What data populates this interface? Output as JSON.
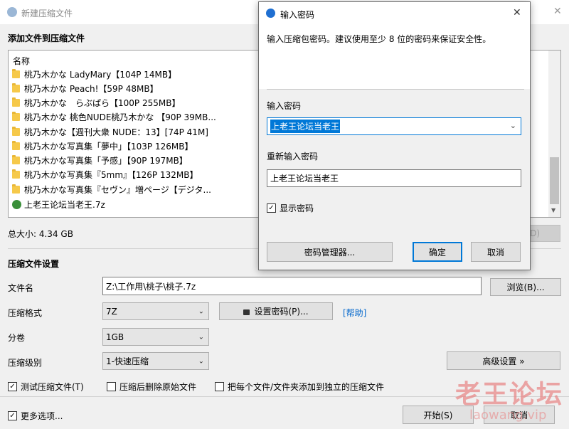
{
  "main_window": {
    "title": "新建压缩文件",
    "add_files_header": "添加文件到压缩文件",
    "list_header": "名称",
    "files": [
      "桃乃木かな LadyMary【104P 14MB】",
      "桃乃木かな Peach!【59P 48MB】",
      "桃乃木かな　らぶぱら【100P 255MB】",
      "桃乃木かな 桃色NUDE桃乃木かな 【90P 39MB...",
      "桃乃木かな【週刊大衆 NUDE：13】[74P 41M]",
      "桃乃木かな写真集「夢中」【103P 126MB】",
      "桃乃木かな写真集「予感」【90P 197MB】",
      "桃乃木かな写真集『5mm』【126P 132MB】",
      "桃乃木かな写真集『セヴン』増ページ【デジタ..."
    ],
    "archive_file": "上老王论坛当老王.7z",
    "total_size": "总大小: 4.34 GB",
    "delete_btn": "(D)",
    "settings_header": "压缩文件设置",
    "filename_label": "文件名",
    "filename_value": "Z:\\工作用\\桃子\\桃子.7z",
    "browse_btn": "浏览(B)...",
    "format_label": "压缩格式",
    "format_value": "7Z",
    "set_password_btn": "设置密码(P)...",
    "help_link": "[帮助]",
    "volume_label": "分卷",
    "volume_value": "1GB",
    "level_label": "压缩级别",
    "level_value": "1-快速压缩",
    "advanced_btn": "高级设置 »",
    "test_check": "测试压缩文件(T)",
    "delete_after_check": "压缩后删除原始文件",
    "each_file_check": "把每个文件/文件夹添加到独立的压缩文件",
    "more_options_check": "更多选项...",
    "start_btn": "开始(S)",
    "cancel_btn": "取消"
  },
  "password_dialog": {
    "title": "输入密码",
    "description": "输入压缩包密码。建议使用至少 8 位的密码来保证安全性。",
    "enter_label": "输入密码",
    "enter_value": "上老王论坛当老王",
    "reenter_label": "重新输入密码",
    "reenter_value": "上老王论坛当老王",
    "show_password": "显示密码",
    "manager_btn": "密码管理器...",
    "ok_btn": "确定",
    "cancel_btn": "取消"
  },
  "watermark": {
    "text": "老王论坛",
    "url": "laowang.vip"
  },
  "colors": {
    "accent": "#0078d7",
    "selection": "#0078d7",
    "link": "#0066cc",
    "watermark": "#e88a8a"
  }
}
